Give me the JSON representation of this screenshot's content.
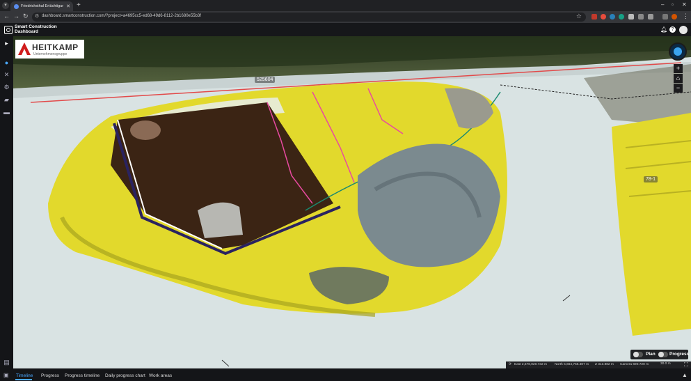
{
  "browser": {
    "tab_title": "Friedrichsthal Ertüchtigung Bu...",
    "url": "dashboard.smartconstruction.com/?project=a4695cc5-ed68-49d6-8112-2b1680e55b3f",
    "new_tab": "+"
  },
  "app": {
    "brand_line1": "Smart Construction",
    "brand_line2": "Dashboard"
  },
  "viewport": {
    "company_name": "HEITKAMP",
    "company_subtitle": "Unternehmensgruppe",
    "label_a": "525604",
    "label_b": "78-1"
  },
  "toggles": {
    "plan": "Plan",
    "progress": "Progress"
  },
  "coords": {
    "east": "East 2,578,020.732 m",
    "north": "North 5,664,756.307 m",
    "z": "Z 313.882 m",
    "camera": "Camera 690.720 m",
    "scale": "30.0 m"
  },
  "bottom_tabs": [
    "Timeline",
    "Progress",
    "Progress timeline",
    "Daily progress chart",
    "Work areas"
  ],
  "colors": {
    "accent": "#4aa8ff",
    "terrain_yellow": "#e2d92c",
    "terrain_white": "#dde6e6",
    "excavation_brown": "#3b2414",
    "magenta_line": "#e84aa0",
    "red_line": "#e24a4a"
  }
}
